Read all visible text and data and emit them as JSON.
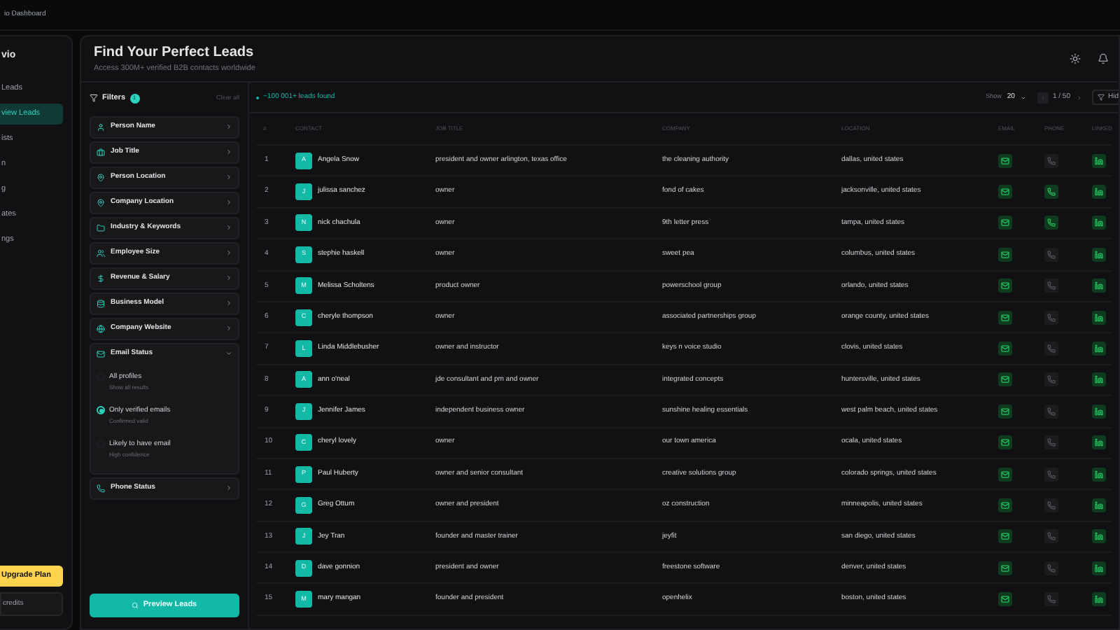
{
  "top_bar": {
    "title": "io Dashboard"
  },
  "sidebar": {
    "brand": "vio",
    "items": [
      {
        "label": "Leads",
        "selected": false
      },
      {
        "label": "view Leads",
        "selected": true
      },
      {
        "label": "ists",
        "selected": false
      },
      {
        "label": "n",
        "selected": false
      },
      {
        "label": "g",
        "selected": false
      },
      {
        "label": "ates",
        "selected": false
      },
      {
        "label": "ngs",
        "selected": false
      }
    ],
    "upgrade_button": "Upgrade Plan",
    "credits": "credits"
  },
  "header": {
    "title": "Find Your Perfect Leads",
    "subtitle": "Access 300M+ verified B2B contacts worldwide"
  },
  "filters": {
    "title": "Filters",
    "count": "1",
    "clear": "Clear all",
    "items": [
      {
        "kind": "person",
        "label": "Person Name",
        "expanded": false
      },
      {
        "kind": "briefcase",
        "label": "Job Title",
        "expanded": false
      },
      {
        "kind": "pin",
        "label": "Person Location",
        "expanded": false
      },
      {
        "kind": "pin",
        "label": "Company Location",
        "expanded": false
      },
      {
        "kind": "folder",
        "label": "Industry & Keywords",
        "expanded": false
      },
      {
        "kind": "users",
        "label": "Employee Size",
        "expanded": false
      },
      {
        "kind": "dollar",
        "label": "Revenue & Salary",
        "expanded": false
      },
      {
        "kind": "database",
        "label": "Business Model",
        "expanded": false
      },
      {
        "kind": "globe",
        "label": "Company Website",
        "expanded": false
      },
      {
        "kind": "mail",
        "label": "Email Status",
        "expanded": true,
        "options": [
          {
            "label": "All profiles",
            "hint": "Show all results",
            "selected": false
          },
          {
            "label": "Only verified emails",
            "hint": "Confirmed valid",
            "selected": true
          },
          {
            "label": "Likely to have email",
            "hint": "High confidence",
            "selected": false
          }
        ]
      },
      {
        "kind": "phone",
        "label": "Phone Status",
        "expanded": false
      }
    ],
    "preview_button": "Preview Leads"
  },
  "results": {
    "count": "~100 001+ leads found",
    "show_label": "Show",
    "page_size": "20",
    "page": "1 / 50",
    "hide_button": "Hid"
  },
  "table": {
    "columns": [
      "#",
      "CONTACT",
      "JOB TITLE",
      "COMPANY",
      "LOCATION",
      "EMAIL",
      "PHONE",
      "LINKED"
    ],
    "rows": [
      {
        "index": "1",
        "initial": "A",
        "name": "Angela Snow",
        "job_title": "president and owner arlington, texas office",
        "company": "the cleaning authority",
        "location": "dallas, united states",
        "email": true,
        "phone": false,
        "linkedin": true
      },
      {
        "index": "2",
        "initial": "J",
        "name": "julissa sanchez",
        "job_title": "owner",
        "company": "fond of cakes",
        "location": "jacksonville, united states",
        "email": true,
        "phone": true,
        "linkedin": true
      },
      {
        "index": "3",
        "initial": "N",
        "name": "nick chachula",
        "job_title": "owner",
        "company": "9th letter press",
        "location": "tampa, united states",
        "email": true,
        "phone": true,
        "linkedin": true
      },
      {
        "index": "4",
        "initial": "S",
        "name": "stephie haskell",
        "job_title": "owner",
        "company": "sweet pea",
        "location": "columbus, united states",
        "email": true,
        "phone": false,
        "linkedin": true
      },
      {
        "index": "5",
        "initial": "M",
        "name": "Melissa Scholtens",
        "job_title": "product owner",
        "company": "powerschool group",
        "location": "orlando, united states",
        "email": true,
        "phone": false,
        "linkedin": true
      },
      {
        "index": "6",
        "initial": "C",
        "name": "cheryle thompson",
        "job_title": "owner",
        "company": "associated partnerships group",
        "location": "orange county, united states",
        "email": true,
        "phone": false,
        "linkedin": true
      },
      {
        "index": "7",
        "initial": "L",
        "name": "Linda Middlebusher",
        "job_title": "owner and instructor",
        "company": "keys n voice studio",
        "location": "clovis, united states",
        "email": true,
        "phone": false,
        "linkedin": true
      },
      {
        "index": "8",
        "initial": "A",
        "name": "ann o'neal",
        "job_title": "jde consultant and pm and owner",
        "company": "integrated concepts",
        "location": "huntersville, united states",
        "email": true,
        "phone": false,
        "linkedin": true
      },
      {
        "index": "9",
        "initial": "J",
        "name": "Jennifer James",
        "job_title": "independent business owner",
        "company": "sunshine healing essentials",
        "location": "west palm beach, united states",
        "email": true,
        "phone": false,
        "linkedin": true
      },
      {
        "index": "10",
        "initial": "C",
        "name": "cheryl lovely",
        "job_title": "owner",
        "company": "our town america",
        "location": "ocala, united states",
        "email": true,
        "phone": false,
        "linkedin": true
      },
      {
        "index": "11",
        "initial": "P",
        "name": "Paul Huberty",
        "job_title": "owner and senior consultant",
        "company": "creative solutions group",
        "location": "colorado springs, united states",
        "email": true,
        "phone": false,
        "linkedin": true
      },
      {
        "index": "12",
        "initial": "G",
        "name": "Greg Ottum",
        "job_title": "owner and president",
        "company": "oz construction",
        "location": "minneapolis, united states",
        "email": true,
        "phone": false,
        "linkedin": true
      },
      {
        "index": "13",
        "initial": "J",
        "name": "Jey Tran",
        "job_title": "founder and master trainer",
        "company": "jeyfit",
        "location": "san diego, united states",
        "email": true,
        "phone": false,
        "linkedin": true
      },
      {
        "index": "14",
        "initial": "D",
        "name": "dave gonnion",
        "job_title": "president and owner",
        "company": "freestone software",
        "location": "denver, united states",
        "email": true,
        "phone": false,
        "linkedin": true
      },
      {
        "index": "15",
        "initial": "M",
        "name": "mary mangan",
        "job_title": "founder and president",
        "company": "openhelix",
        "location": "boston, united states",
        "email": true,
        "phone": false,
        "linkedin": true
      }
    ]
  }
}
